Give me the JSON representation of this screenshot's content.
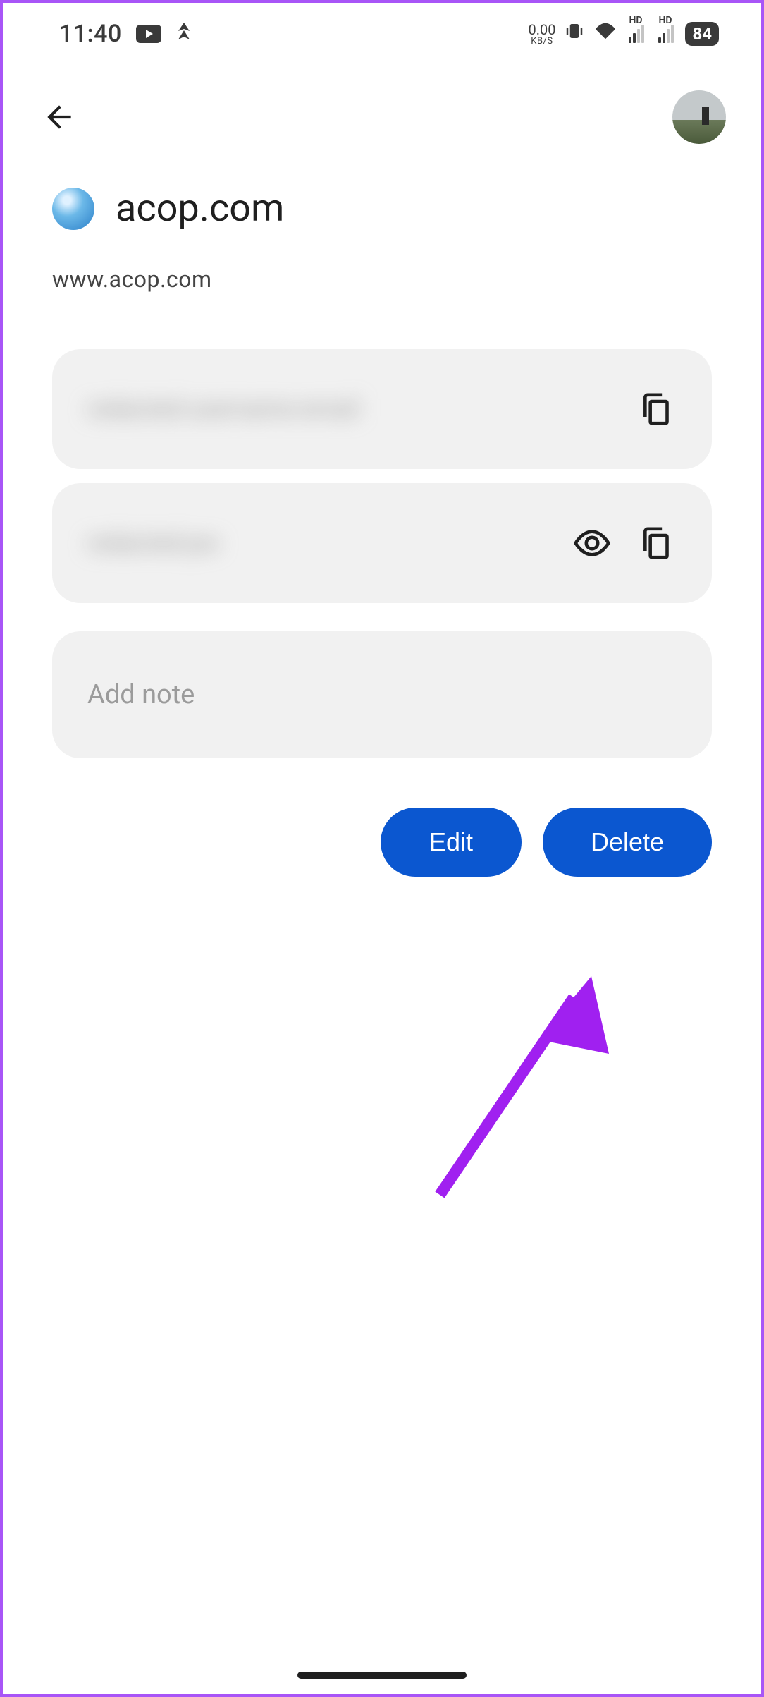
{
  "status": {
    "time": "11:40",
    "data_rate_value": "0.00",
    "data_rate_unit": "KB/S",
    "hd_label_1": "HD",
    "hd_label_2": "HD",
    "battery": "84"
  },
  "site": {
    "title": "acop.com",
    "url": "www.acop.com"
  },
  "fields": {
    "username": "redacted-username-email",
    "password": "redacted-pw"
  },
  "note": {
    "placeholder": "Add note"
  },
  "actions": {
    "edit": "Edit",
    "delete": "Delete"
  }
}
